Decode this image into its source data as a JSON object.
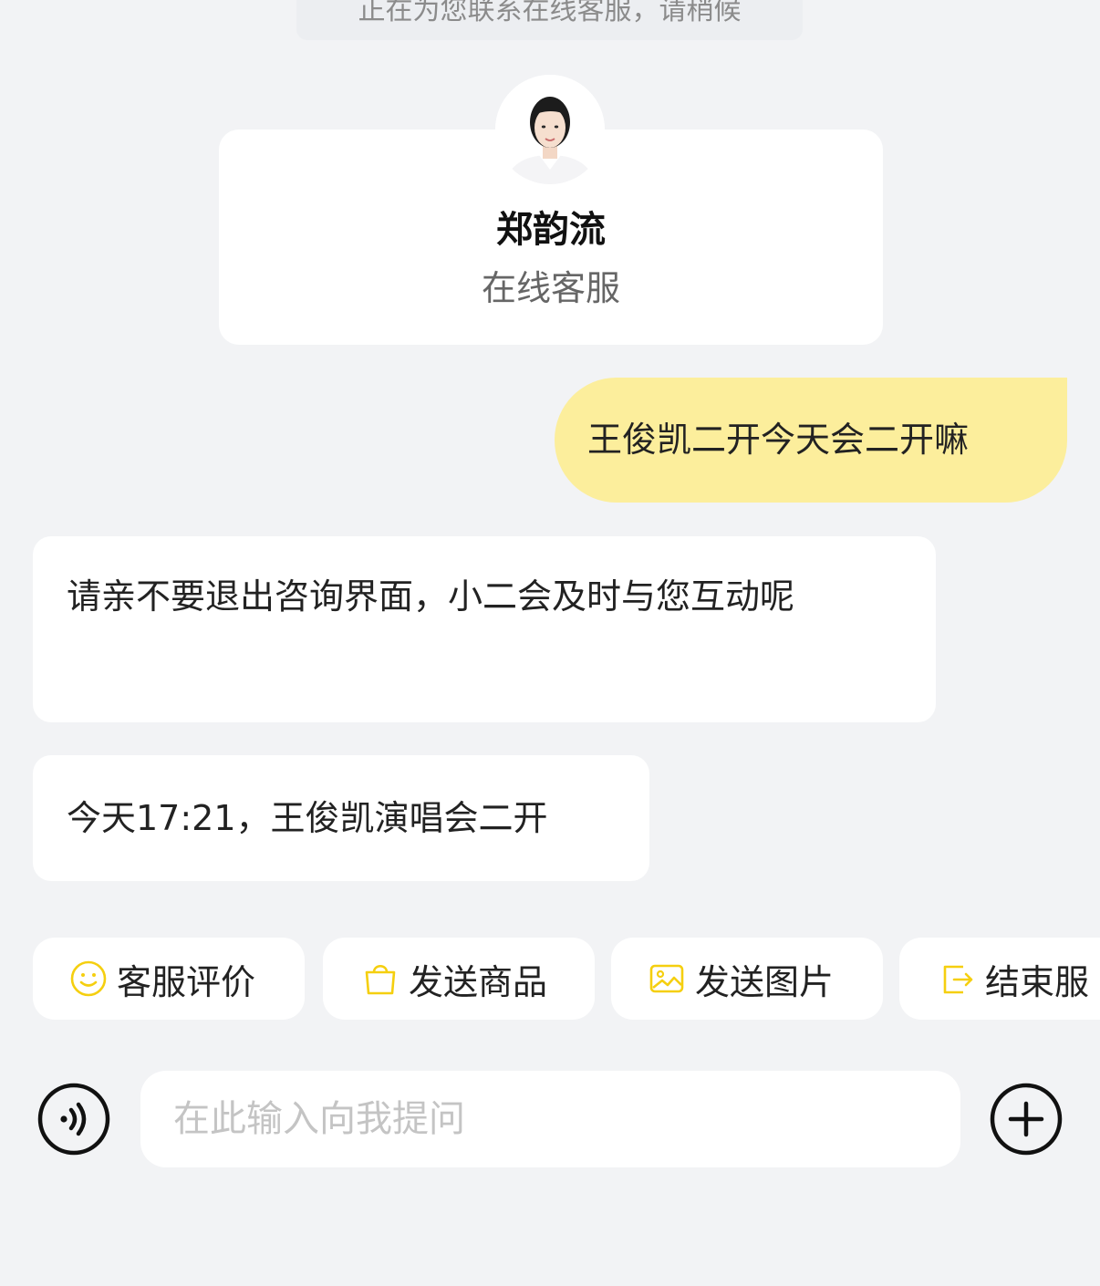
{
  "system_notice": "正在为您联系在线客服，请稍候",
  "agent": {
    "name": "郑韵流",
    "role": "在线客服"
  },
  "messages": [
    {
      "from": "user",
      "text": "王俊凯二开今天会二开嘛"
    },
    {
      "from": "agent",
      "text": "请亲不要退出咨询界面，小二会及时与您互动呢"
    },
    {
      "from": "agent",
      "text": "今天17:21，王俊凯演唱会二开"
    }
  ],
  "quick_actions": [
    {
      "label": "客服评价",
      "icon": "smiley-icon"
    },
    {
      "label": "发送商品",
      "icon": "shopping-bag-icon"
    },
    {
      "label": "发送图片",
      "icon": "image-icon"
    },
    {
      "label": "结束服",
      "icon": "exit-icon"
    }
  ],
  "input": {
    "placeholder": "在此输入向我提问",
    "value": ""
  },
  "colors": {
    "background": "#f2f3f5",
    "user_bubble": "#fcee9c",
    "icon_accent": "#f5cf0f"
  }
}
